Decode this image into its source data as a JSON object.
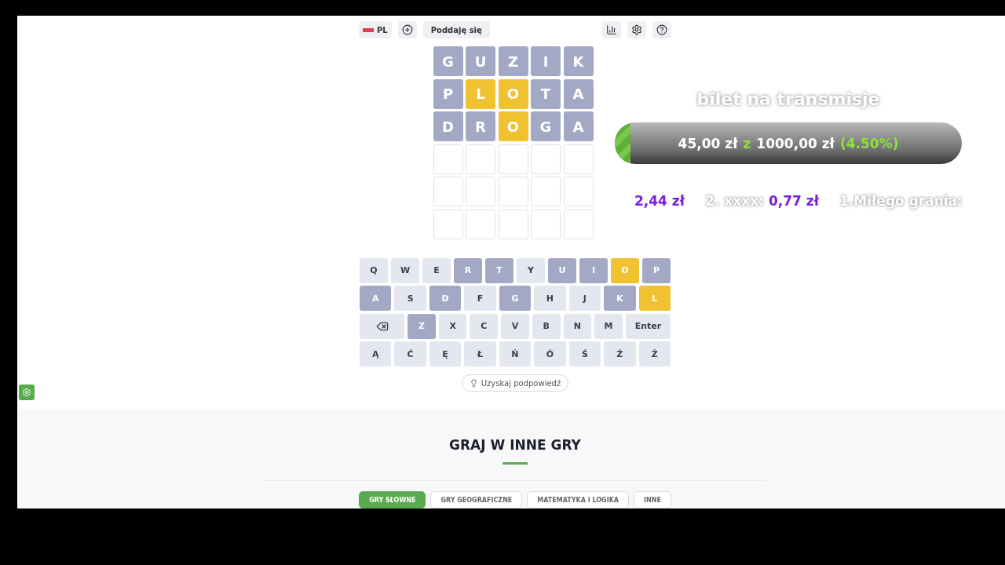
{
  "toolbar": {
    "language": "PL",
    "give_up": "Poddaję się"
  },
  "board": [
    [
      {
        "letter": "G",
        "in_word": false
      },
      {
        "letter": "U",
        "in_word": false
      },
      {
        "letter": "Z",
        "in_word": false
      },
      {
        "letter": "I",
        "in_word": false
      },
      {
        "letter": "K",
        "in_word": false
      }
    ],
    [
      {
        "letter": "P",
        "in_word": false
      },
      {
        "letter": "L",
        "in_word": true
      },
      {
        "letter": "O",
        "in_word": true
      },
      {
        "letter": "T",
        "in_word": false
      },
      {
        "letter": "A",
        "in_word": false
      }
    ],
    [
      {
        "letter": "D",
        "in_word": false
      },
      {
        "letter": "R",
        "in_word": false
      },
      {
        "letter": "O",
        "in_word": true
      },
      {
        "letter": "G",
        "in_word": false
      },
      {
        "letter": "A",
        "in_word": false
      }
    ],
    [
      {
        "filled": false
      },
      {
        "filled": false
      },
      {
        "filled": false
      },
      {
        "filled": false
      },
      {
        "filled": false
      }
    ],
    [
      {
        "filled": false
      },
      {
        "filled": false
      },
      {
        "filled": false
      },
      {
        "filled": false
      },
      {
        "filled": false
      }
    ],
    [
      {
        "filled": false
      },
      {
        "filled": false
      },
      {
        "filled": false
      },
      {
        "filled": false
      },
      {
        "filled": false
      }
    ]
  ],
  "keyboard": [
    [
      {
        "kind": "letter",
        "label": "Q",
        "used": false
      },
      {
        "kind": "letter",
        "label": "W",
        "used": false
      },
      {
        "kind": "letter",
        "label": "E",
        "used": false
      },
      {
        "kind": "letter",
        "label": "R",
        "used": true,
        "in_word": false
      },
      {
        "kind": "letter",
        "label": "T",
        "used": true,
        "in_word": false
      },
      {
        "kind": "letter",
        "label": "Y",
        "used": false
      },
      {
        "kind": "letter",
        "label": "U",
        "used": true,
        "in_word": false
      },
      {
        "kind": "letter",
        "label": "I",
        "used": true,
        "in_word": false
      },
      {
        "kind": "letter",
        "label": "O",
        "used": true,
        "in_word": true
      },
      {
        "kind": "letter",
        "label": "P",
        "used": true,
        "in_word": false
      }
    ],
    [
      {
        "kind": "letter",
        "label": "A",
        "used": true,
        "in_word": false
      },
      {
        "kind": "letter",
        "label": "S",
        "used": false
      },
      {
        "kind": "letter",
        "label": "D",
        "used": true,
        "in_word": false
      },
      {
        "kind": "letter",
        "label": "F",
        "used": false
      },
      {
        "kind": "letter",
        "label": "G",
        "used": true,
        "in_word": false
      },
      {
        "kind": "letter",
        "label": "H",
        "used": false
      },
      {
        "kind": "letter",
        "label": "J",
        "used": false
      },
      {
        "kind": "letter",
        "label": "K",
        "used": true,
        "in_word": false
      },
      {
        "kind": "letter",
        "label": "L",
        "used": true,
        "in_word": true
      }
    ],
    [
      {
        "kind": "backspace"
      },
      {
        "kind": "letter",
        "label": "Z",
        "used": true,
        "in_word": false
      },
      {
        "kind": "letter",
        "label": "X",
        "used": false
      },
      {
        "kind": "letter",
        "label": "C",
        "used": false
      },
      {
        "kind": "letter",
        "label": "V",
        "used": false
      },
      {
        "kind": "letter",
        "label": "B",
        "used": false
      },
      {
        "kind": "letter",
        "label": "N",
        "used": false
      },
      {
        "kind": "letter",
        "label": "M",
        "used": false
      },
      {
        "kind": "enter",
        "label": "Enter"
      }
    ],
    [
      {
        "kind": "letter",
        "label": "Ą",
        "used": false
      },
      {
        "kind": "letter",
        "label": "Ć",
        "used": false
      },
      {
        "kind": "letter",
        "label": "Ę",
        "used": false
      },
      {
        "kind": "letter",
        "label": "Ł",
        "used": false
      },
      {
        "kind": "letter",
        "label": "Ń",
        "used": false
      },
      {
        "kind": "letter",
        "label": "Ó",
        "used": false
      },
      {
        "kind": "letter",
        "label": "Ś",
        "used": false
      },
      {
        "kind": "letter",
        "label": "Ź",
        "used": false
      },
      {
        "kind": "letter",
        "label": "Ż",
        "used": false
      }
    ]
  ],
  "hint_button": "Uzyskaj podpowiedź",
  "stream_overlay": {
    "goal_title": "bilet na transmisje",
    "goal": {
      "current": "45,00 zł",
      "separator": "z",
      "target": "1000,00 zł",
      "percent": "(4.50%)",
      "level": 0.045
    },
    "ticker": [
      {
        "amount": "2,44 zł"
      },
      {
        "name": "2. xxxx:",
        "amount": "0,77 zł"
      },
      {
        "name": "1.Miłego grania:"
      }
    ]
  },
  "more_games": {
    "title": "GRAJ W INNE GRY",
    "tabs": [
      {
        "label": "GRY SŁOWNE",
        "selected": true
      },
      {
        "label": "GRY GEOGRAFICZNE",
        "selected": false
      },
      {
        "label": "MATEMATYKA I LOGIKA",
        "selected": false
      },
      {
        "label": "INNE",
        "selected": false
      }
    ]
  }
}
